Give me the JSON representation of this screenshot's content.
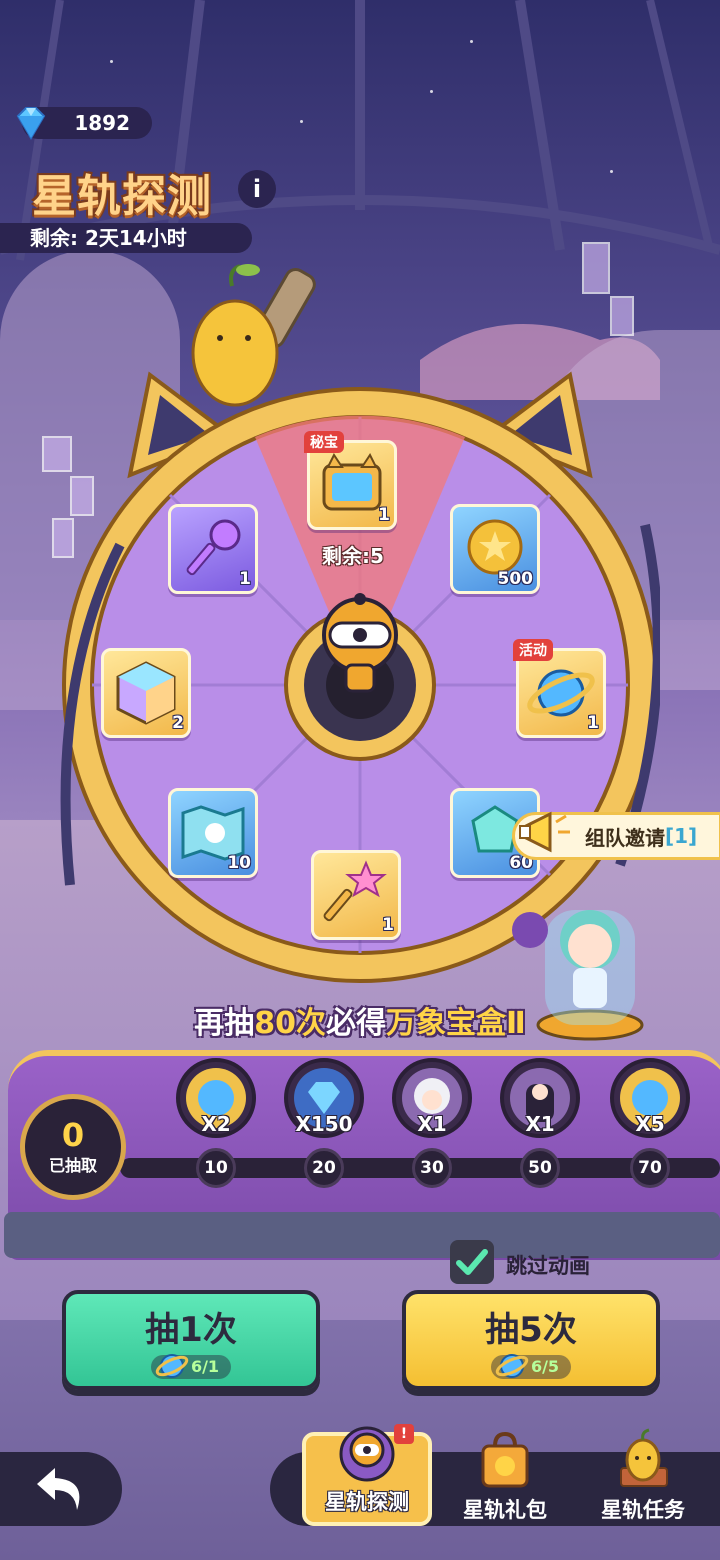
{
  "currency": {
    "gems": "1892",
    "icon": "diamond-icon"
  },
  "event": {
    "title": "星轨探测",
    "info_icon": "i",
    "timer": "剩余: 2天14小时"
  },
  "wheel": {
    "items": [
      {
        "id": "treasure",
        "tag": "秘宝",
        "count": "1",
        "icon": "tv-box-icon",
        "tile": "gold"
      },
      {
        "id": "gold-coin",
        "count": "500",
        "icon": "coin-icon",
        "tile": "blue"
      },
      {
        "id": "star-orb",
        "tag": "活动",
        "count": "1",
        "icon": "orb-icon",
        "tile": "gold"
      },
      {
        "id": "crystal",
        "count": "60",
        "icon": "crystal-icon",
        "tile": "blue"
      },
      {
        "id": "star-key",
        "count": "1",
        "icon": "star-key-icon",
        "tile": "gold"
      },
      {
        "id": "map",
        "count": "10",
        "icon": "map-icon",
        "tile": "blue"
      },
      {
        "id": "cube",
        "count": "2",
        "icon": "cube-icon",
        "tile": "gold"
      },
      {
        "id": "purple-key",
        "count": "1",
        "icon": "purple-key-icon",
        "tile": "purple"
      }
    ],
    "remaining_label": "剩余:5"
  },
  "team_invite": {
    "label": "组队邀请",
    "count": "[1]"
  },
  "banner": {
    "prefix": "再抽",
    "count": "80次",
    "middle": "必得",
    "reward": "万象宝盒Ⅱ"
  },
  "progress": {
    "drawn_count": "0",
    "drawn_label": "已抽取",
    "milestones": [
      {
        "at": "10",
        "qty": "X2",
        "icon": "orb-icon"
      },
      {
        "at": "20",
        "qty": "X150",
        "icon": "diamond-icon"
      },
      {
        "at": "30",
        "qty": "X1",
        "icon": "character-white-icon"
      },
      {
        "at": "50",
        "qty": "X1",
        "icon": "character-dark-icon"
      },
      {
        "at": "70",
        "qty": "X5",
        "icon": "orb-icon"
      }
    ]
  },
  "skip_animation": {
    "label": "跳过动画",
    "checked": true
  },
  "draw_buttons": [
    {
      "label": "抽1次",
      "cost": "6/1"
    },
    {
      "label": "抽5次",
      "cost": "6/5"
    }
  ],
  "nav": {
    "items": [
      {
        "label": "星轨探测",
        "icon": "robot-icon",
        "active": true
      },
      {
        "label": "星轨礼包",
        "icon": "gift-bag-icon",
        "active": false
      },
      {
        "label": "星轨任务",
        "icon": "pear-mascot-icon",
        "active": false
      }
    ],
    "alert": "!"
  },
  "colors": {
    "accent_gold": "#f6c04b",
    "accent_green": "#33c595",
    "wheel_purple": "#b98ee8",
    "title_orange": "#ffd38a"
  }
}
